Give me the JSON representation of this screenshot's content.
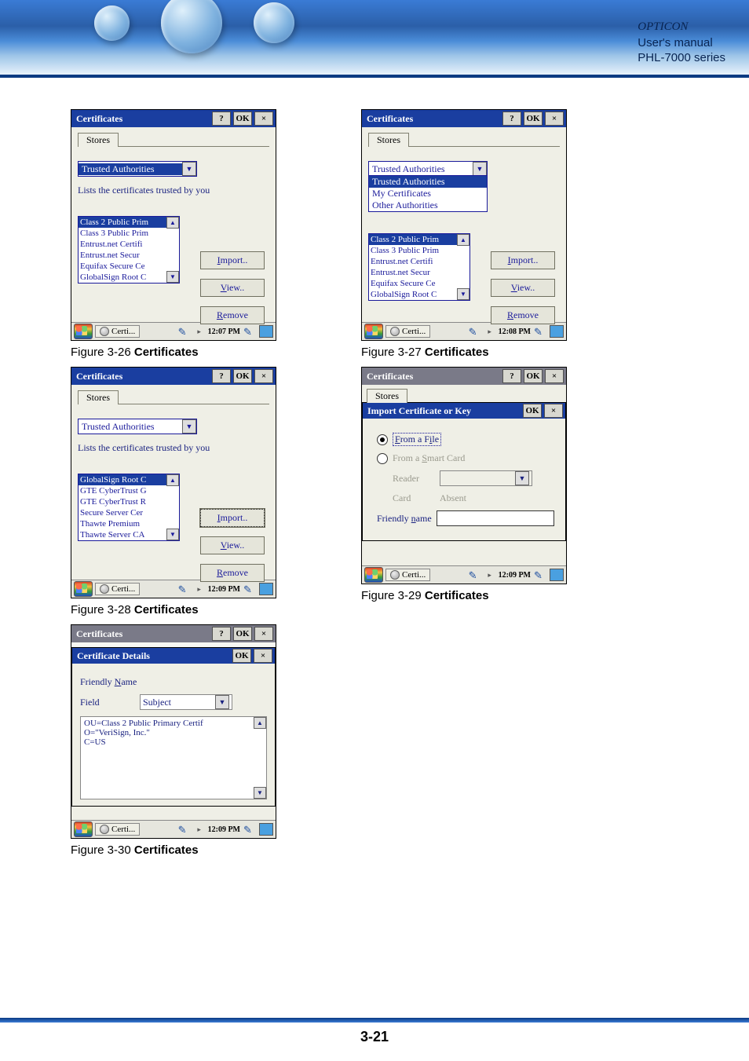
{
  "header": {
    "brand": "OPTICON",
    "line2": "User's manual",
    "line3": "PHL-7000 series"
  },
  "page_number": "3-21",
  "buttons": {
    "help": "?",
    "ok": "OK",
    "close": "×",
    "import": "Import..",
    "view": "View..",
    "remove": "Remove",
    "up": "▲",
    "down": "▼",
    "dd": "▼",
    "tri": "▸"
  },
  "figures": [
    {
      "id": "26",
      "caption_pre": "Figure 3-26 ",
      "caption": "Certificates",
      "title": "Certificates",
      "tab": "Stores",
      "dropdown_selected": "Trusted Authorities",
      "hint": "Lists the certificates trusted by you",
      "list": [
        "Class 2 Public Prim",
        "Class 3 Public Prim",
        "Entrust.net Certifi",
        "Entrust.net Secur",
        "Equifax Secure Ce",
        "GlobalSign Root C"
      ],
      "selected_index": 0,
      "time": "12:07 PM",
      "task": "Certi..."
    },
    {
      "id": "27",
      "caption_pre": "Figure 3-27 ",
      "caption": "Certificates",
      "title": "Certificates",
      "tab": "Stores",
      "dropdown_selected": "Trusted Authorities",
      "dropdown_options": [
        "Trusted Authorities",
        "My Certificates",
        "Other Authorities"
      ],
      "list": [
        "Class 2 Public Prim",
        "Class 3 Public Prim",
        "Entrust.net Certifi",
        "Entrust.net Secur",
        "Equifax Secure Ce",
        "GlobalSign Root C"
      ],
      "selected_index": 0,
      "time": "12:08 PM",
      "task": "Certi..."
    },
    {
      "id": "28",
      "caption_pre": "Figure 3-28 ",
      "caption": "Certificates",
      "title": "Certificates",
      "tab": "Stores",
      "dropdown_selected": "Trusted Authorities",
      "hint": "Lists the certificates trusted by you",
      "list": [
        "GlobalSign Root C",
        "GTE CyberTrust G",
        "GTE CyberTrust R",
        "Secure Server Cer",
        "Thawte Premium",
        "Thawte Server CA"
      ],
      "selected_index": 0,
      "time": "12:09 PM",
      "task": "Certi...",
      "import_focus": true
    },
    {
      "id": "29",
      "caption_pre": "Figure 3-29 ",
      "caption": "Certificates",
      "title": "Certificates",
      "tab": "Stores",
      "sub_title": "Import Certificate or Key",
      "radios": {
        "file": "From a File",
        "smart": "From a Smart Card"
      },
      "labels": {
        "reader": "Reader",
        "card": "Card",
        "absent": "Absent",
        "friendly": "Friendly name"
      },
      "time": "12:09 PM",
      "task": "Certi..."
    },
    {
      "id": "30",
      "caption_pre": "Figure 3-30 ",
      "caption": "Certificates",
      "title": "Certificates",
      "sub_title": "Certificate Details",
      "labels": {
        "friendly": "Friendly Name",
        "field": "Field",
        "subject": "Subject"
      },
      "detail_lines": [
        "OU=Class 2 Public Primary Certif",
        "O=\"VeriSign, Inc.\"",
        "C=US"
      ],
      "time": "12:09 PM",
      "task": "Certi..."
    }
  ]
}
